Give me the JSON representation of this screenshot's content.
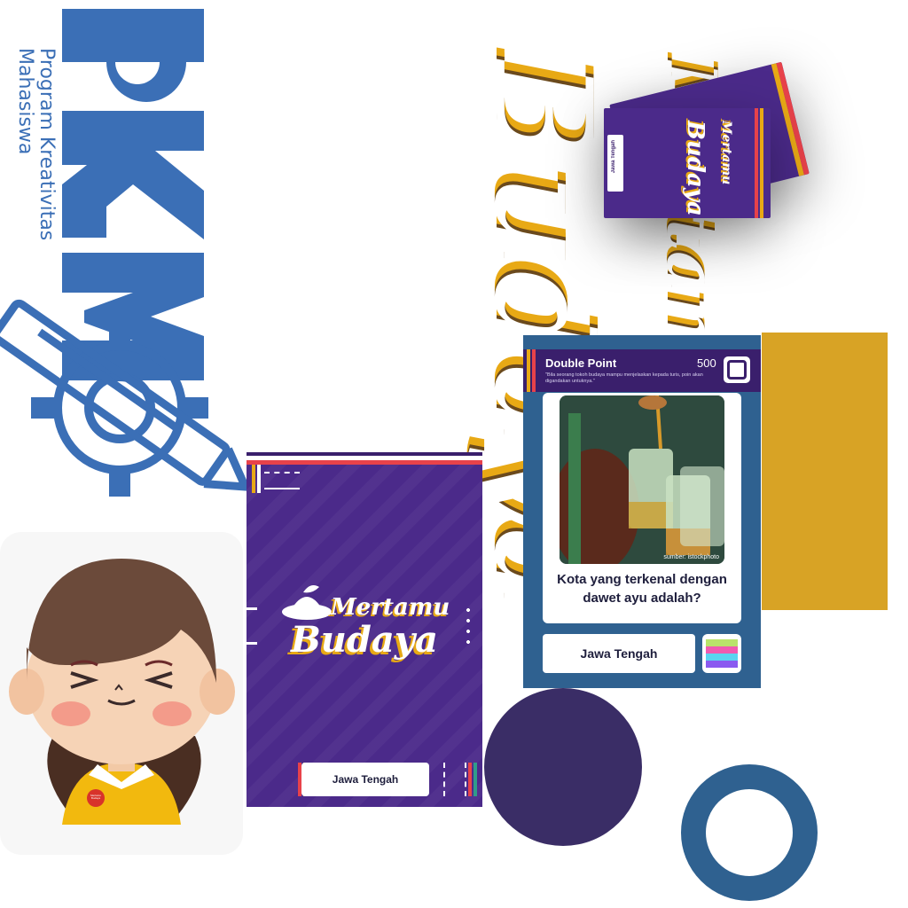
{
  "pkm": {
    "logo_text": "PKM",
    "subtitle_line1": "Program Kreativitas",
    "subtitle_line2": "Mahasiswa"
  },
  "title": {
    "line1": "Mertamu",
    "line2": "Budaya"
  },
  "card_back": {
    "region": "Jawa Tengah"
  },
  "question_card": {
    "label": "Double Point",
    "points": "500",
    "rule": "\"Bila seorang tokoh budaya mampu menjelaskan kepada turis, poin akan digandakan untuknya.\"",
    "photo_credit": "sumber: istockphoto",
    "question": "Kota yang terkenal dengan dawet ayu adalah?",
    "answer": "Jawa Tengah"
  },
  "mini_cards": {
    "side_label": "Jawa Tengah"
  },
  "avatar": {
    "badge_text": "Mertamu Budaya"
  },
  "colors": {
    "purple": "#4b2a8a",
    "navy_purple": "#3a1f6c",
    "blue": "#2f6190",
    "pkm_blue": "#3b6fb6",
    "gold": "#d8a325",
    "orange": "#e8a915",
    "red": "#e8424a"
  }
}
